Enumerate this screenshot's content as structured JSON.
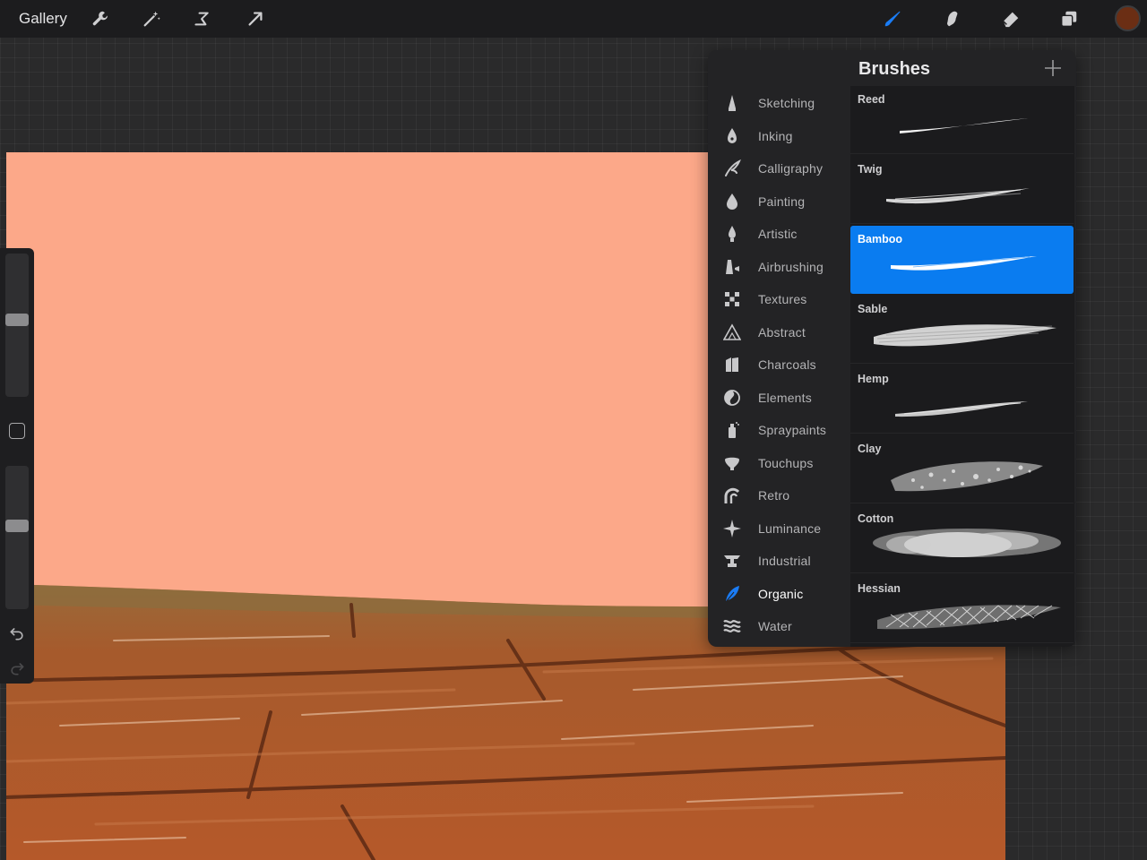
{
  "topbar": {
    "gallery_label": "Gallery",
    "left_tools": [
      "wrench-icon",
      "magic-wand-icon",
      "selection-icon",
      "transform-icon"
    ],
    "right_tools": [
      "brush-icon",
      "smudge-icon",
      "eraser-icon",
      "layers-icon"
    ],
    "active_tool": "brush-icon",
    "active_tool_color": "#1a7cf5",
    "current_color": "#6b2e14"
  },
  "canvas": {
    "sky_color": "#fca889",
    "ground_color": "#a9552a"
  },
  "sidebar": {
    "size_slider_level": 0.54,
    "opacity_slider_level": 0.59,
    "controls": [
      "brush-size-slider",
      "modify-button",
      "opacity-slider",
      "undo-icon",
      "redo-icon"
    ]
  },
  "brushes": {
    "title": "Brushes",
    "sets": [
      {
        "label": "Sketching",
        "icon": "sketching-icon"
      },
      {
        "label": "Inking",
        "icon": "inking-icon"
      },
      {
        "label": "Calligraphy",
        "icon": "calligraphy-icon"
      },
      {
        "label": "Painting",
        "icon": "painting-icon"
      },
      {
        "label": "Artistic",
        "icon": "artistic-icon"
      },
      {
        "label": "Airbrushing",
        "icon": "airbrushing-icon"
      },
      {
        "label": "Textures",
        "icon": "textures-icon"
      },
      {
        "label": "Abstract",
        "icon": "abstract-icon"
      },
      {
        "label": "Charcoals",
        "icon": "charcoals-icon"
      },
      {
        "label": "Elements",
        "icon": "elements-icon"
      },
      {
        "label": "Spraypaints",
        "icon": "spraypaints-icon"
      },
      {
        "label": "Touchups",
        "icon": "touchups-icon"
      },
      {
        "label": "Retro",
        "icon": "retro-icon"
      },
      {
        "label": "Luminance",
        "icon": "luminance-icon"
      },
      {
        "label": "Industrial",
        "icon": "industrial-icon"
      },
      {
        "label": "Organic",
        "icon": "organic-icon"
      },
      {
        "label": "Water",
        "icon": "water-icon"
      }
    ],
    "active_set": "Organic",
    "items": [
      {
        "name": "Reed"
      },
      {
        "name": "Twig"
      },
      {
        "name": "Bamboo"
      },
      {
        "name": "Sable"
      },
      {
        "name": "Hemp"
      },
      {
        "name": "Clay"
      },
      {
        "name": "Cotton"
      },
      {
        "name": "Hessian"
      }
    ],
    "selected_brush": "Bamboo",
    "selected_color": "#0a7cf0"
  }
}
